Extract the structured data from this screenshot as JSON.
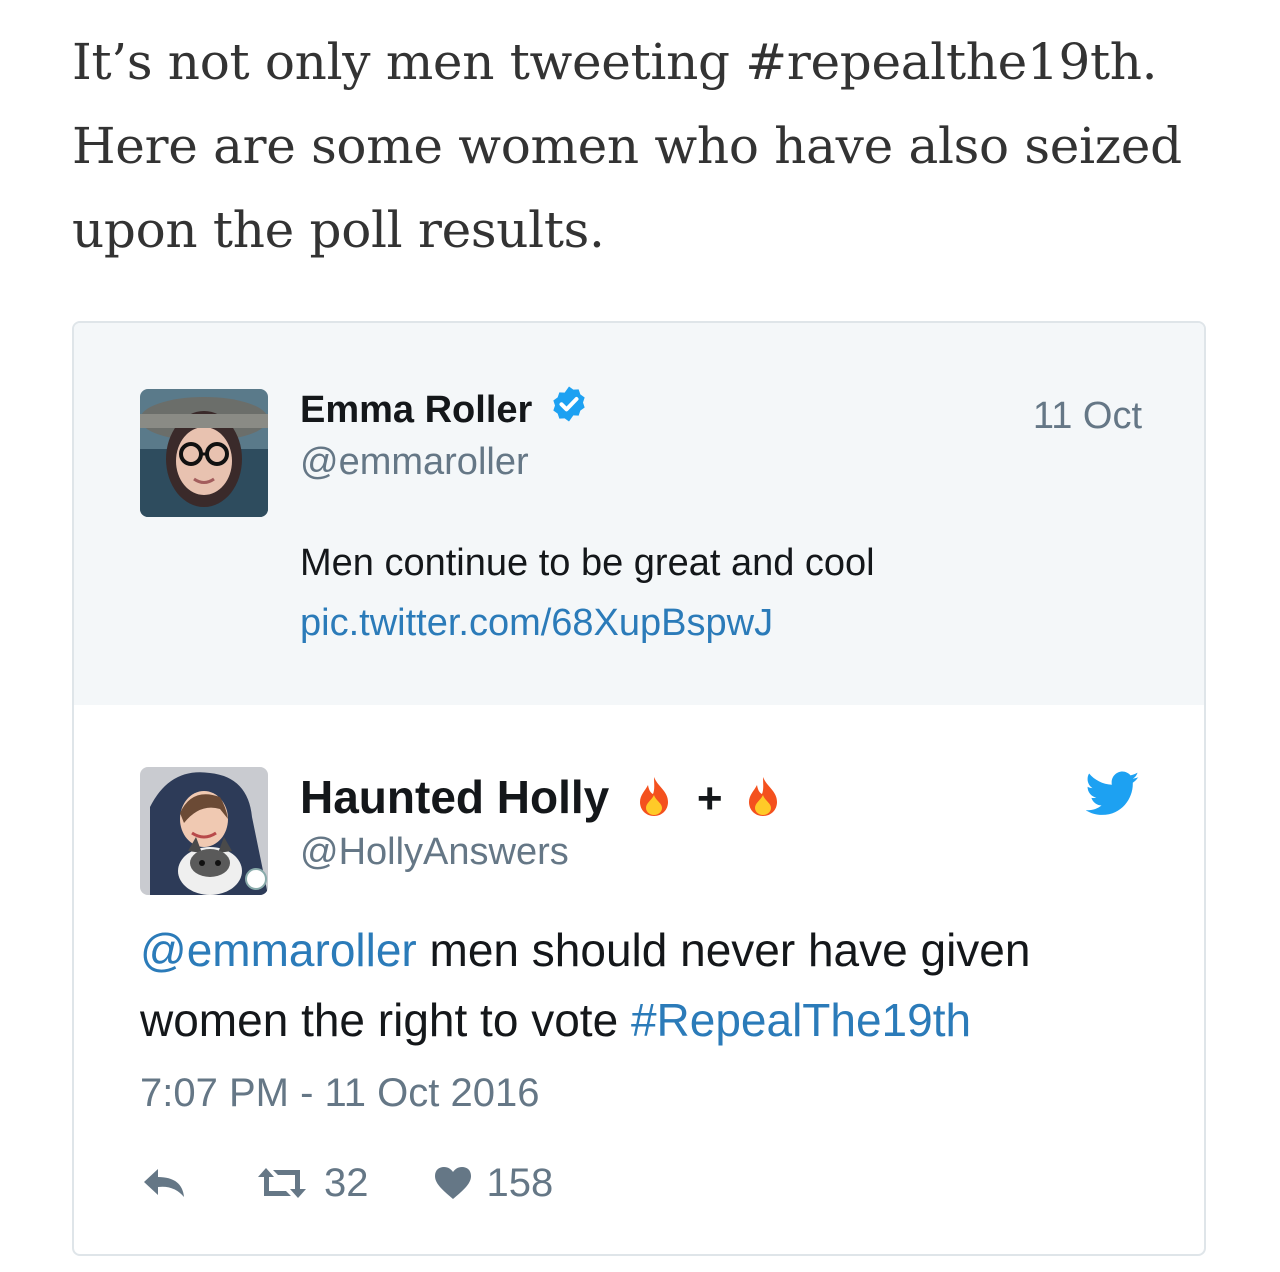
{
  "article": {
    "line1": "It’s not only men tweeting #repealthe19th.",
    "line2": "Here are some women who have also seized",
    "line3": "upon the poll results."
  },
  "quoted_tweet": {
    "name": "Emma Roller",
    "handle": "@emmaroller",
    "date": "11 Oct",
    "text": "Men continue to be great and cool",
    "link": "pic.twitter.com/68XupBspwJ"
  },
  "tweet": {
    "name": "Haunted Holly",
    "name_suffix": "+",
    "handle": "@HollyAnswers",
    "mention": "@emmaroller",
    "text_part1": " men should never have given",
    "text_part2": "women the right to vote ",
    "hashtag": "#RepealThe19th",
    "timestamp": "7:07 PM - 11 Oct 2016",
    "retweets": "32",
    "likes": "158"
  },
  "colors": {
    "link": "#2b7bb9",
    "verified": "#1da1f2",
    "twitter_bird": "#1da1f2",
    "muted": "#657786",
    "quoted_bg": "#f4f7f9"
  },
  "icons": [
    "verified-badge-icon",
    "fire-icon",
    "twitter-bird-icon",
    "reply-icon",
    "retweet-icon",
    "heart-icon"
  ]
}
